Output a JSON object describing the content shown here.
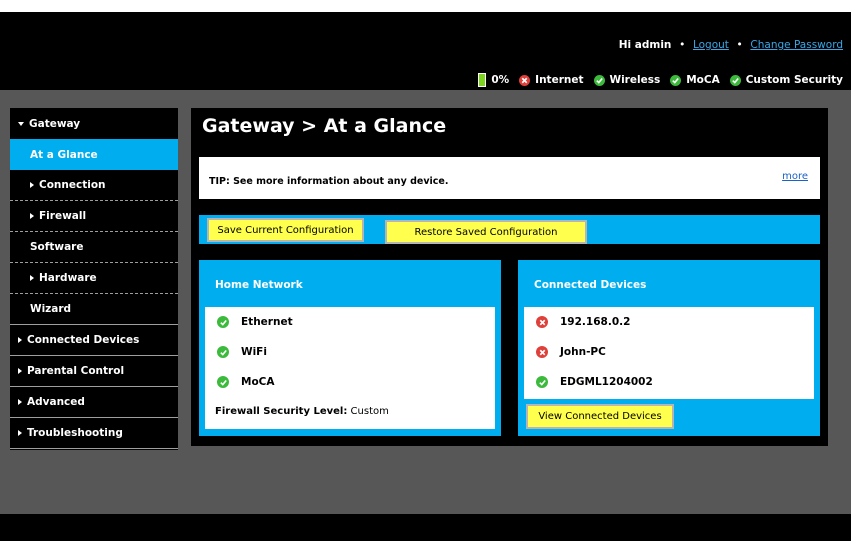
{
  "header": {
    "greeting": "Hi admin",
    "logout": "Logout",
    "change_password": "Change Password",
    "battery": "0%",
    "status": [
      {
        "label": "Internet",
        "state": "error"
      },
      {
        "label": "Wireless",
        "state": "ok"
      },
      {
        "label": "MoCA",
        "state": "ok"
      },
      {
        "label": "Custom Security",
        "state": "ok"
      }
    ]
  },
  "sidebar": {
    "items": [
      {
        "label": "Gateway"
      },
      {
        "label": "At a Glance"
      },
      {
        "label": "Connection"
      },
      {
        "label": "Firewall"
      },
      {
        "label": "Software"
      },
      {
        "label": "Hardware"
      },
      {
        "label": "Wizard"
      },
      {
        "label": "Connected Devices"
      },
      {
        "label": "Parental Control"
      },
      {
        "label": "Advanced"
      },
      {
        "label": "Troubleshooting"
      }
    ]
  },
  "main": {
    "title": "Gateway > At a Glance",
    "tip": "TIP: See more information about any device.",
    "more": "more",
    "save_button": "Save Current Configuration",
    "restore_button": "Restore Saved Configuration",
    "home_network": {
      "title": "Home Network",
      "items": [
        {
          "label": "Ethernet",
          "state": "ok"
        },
        {
          "label": "WiFi",
          "state": "ok"
        },
        {
          "label": "MoCA",
          "state": "ok"
        }
      ],
      "firewall_label": "Firewall Security Level:",
      "firewall_value": "Custom"
    },
    "connected_devices": {
      "title": "Connected Devices",
      "items": [
        {
          "label": "192.168.0.2",
          "state": "error"
        },
        {
          "label": "John-PC",
          "state": "error"
        },
        {
          "label": "EDGML1204002",
          "state": "ok"
        }
      ],
      "view_button": "View Connected Devices"
    }
  },
  "colors": {
    "accent": "#00aeef",
    "ok": "#3cba3c",
    "error": "#e0403a",
    "button": "#ffff4d",
    "link": "#39a7e8"
  }
}
